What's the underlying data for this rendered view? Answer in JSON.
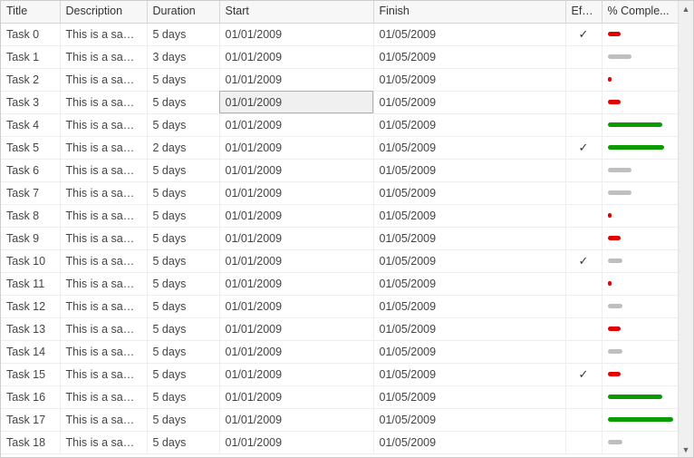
{
  "columns": {
    "title": "Title",
    "description": "Description",
    "duration": "Duration",
    "start": "Start",
    "finish": "Finish",
    "effort": "Effo...",
    "pct": "% Comple..."
  },
  "checkmark": "✓",
  "scroll": {
    "up": "▲",
    "down": "▼"
  },
  "bar_colors": {
    "red": "#e30000",
    "gray": "#bfbfbf",
    "green": "#0a9b00"
  },
  "selected_cell": {
    "row": 3,
    "col": "start"
  },
  "rows": [
    {
      "title": "Task 0",
      "description": "This is a sam...",
      "duration": "5 days",
      "start": "01/01/2009",
      "finish": "01/05/2009",
      "effort": true,
      "pct_width": 14,
      "pct_color": "red"
    },
    {
      "title": "Task 1",
      "description": "This is a sam...",
      "duration": "3 days",
      "start": "01/01/2009",
      "finish": "01/05/2009",
      "effort": false,
      "pct_width": 26,
      "pct_color": "gray"
    },
    {
      "title": "Task 2",
      "description": "This is a sam...",
      "duration": "5 days",
      "start": "01/01/2009",
      "finish": "01/05/2009",
      "effort": false,
      "pct_width": 4,
      "pct_color": "red"
    },
    {
      "title": "Task 3",
      "description": "This is a sam...",
      "duration": "5 days",
      "start": "01/01/2009",
      "finish": "01/05/2009",
      "effort": false,
      "pct_width": 14,
      "pct_color": "red"
    },
    {
      "title": "Task 4",
      "description": "This is a sam...",
      "duration": "5 days",
      "start": "01/01/2009",
      "finish": "01/05/2009",
      "effort": false,
      "pct_width": 60,
      "pct_color": "green"
    },
    {
      "title": "Task 5",
      "description": "This is a sam...",
      "duration": "2 days",
      "start": "01/01/2009",
      "finish": "01/05/2009",
      "effort": true,
      "pct_width": 62,
      "pct_color": "green"
    },
    {
      "title": "Task 6",
      "description": "This is a sam...",
      "duration": "5 days",
      "start": "01/01/2009",
      "finish": "01/05/2009",
      "effort": false,
      "pct_width": 26,
      "pct_color": "gray"
    },
    {
      "title": "Task 7",
      "description": "This is a sam...",
      "duration": "5 days",
      "start": "01/01/2009",
      "finish": "01/05/2009",
      "effort": false,
      "pct_width": 26,
      "pct_color": "gray"
    },
    {
      "title": "Task 8",
      "description": "This is a sam...",
      "duration": "5 days",
      "start": "01/01/2009",
      "finish": "01/05/2009",
      "effort": false,
      "pct_width": 4,
      "pct_color": "red"
    },
    {
      "title": "Task 9",
      "description": "This is a sam...",
      "duration": "5 days",
      "start": "01/01/2009",
      "finish": "01/05/2009",
      "effort": false,
      "pct_width": 14,
      "pct_color": "red"
    },
    {
      "title": "Task 10",
      "description": "This is a sam...",
      "duration": "5 days",
      "start": "01/01/2009",
      "finish": "01/05/2009",
      "effort": true,
      "pct_width": 16,
      "pct_color": "gray"
    },
    {
      "title": "Task 11",
      "description": "This is a sam...",
      "duration": "5 days",
      "start": "01/01/2009",
      "finish": "01/05/2009",
      "effort": false,
      "pct_width": 4,
      "pct_color": "red"
    },
    {
      "title": "Task 12",
      "description": "This is a sam...",
      "duration": "5 days",
      "start": "01/01/2009",
      "finish": "01/05/2009",
      "effort": false,
      "pct_width": 16,
      "pct_color": "gray"
    },
    {
      "title": "Task 13",
      "description": "This is a sam...",
      "duration": "5 days",
      "start": "01/01/2009",
      "finish": "01/05/2009",
      "effort": false,
      "pct_width": 14,
      "pct_color": "red"
    },
    {
      "title": "Task 14",
      "description": "This is a sam...",
      "duration": "5 days",
      "start": "01/01/2009",
      "finish": "01/05/2009",
      "effort": false,
      "pct_width": 16,
      "pct_color": "gray"
    },
    {
      "title": "Task 15",
      "description": "This is a sam...",
      "duration": "5 days",
      "start": "01/01/2009",
      "finish": "01/05/2009",
      "effort": true,
      "pct_width": 14,
      "pct_color": "red"
    },
    {
      "title": "Task 16",
      "description": "This is a sam...",
      "duration": "5 days",
      "start": "01/01/2009",
      "finish": "01/05/2009",
      "effort": false,
      "pct_width": 60,
      "pct_color": "green"
    },
    {
      "title": "Task 17",
      "description": "This is a sam...",
      "duration": "5 days",
      "start": "01/01/2009",
      "finish": "01/05/2009",
      "effort": false,
      "pct_width": 72,
      "pct_color": "green"
    },
    {
      "title": "Task 18",
      "description": "This is a sam...",
      "duration": "5 days",
      "start": "01/01/2009",
      "finish": "01/05/2009",
      "effort": false,
      "pct_width": 16,
      "pct_color": "gray"
    }
  ]
}
